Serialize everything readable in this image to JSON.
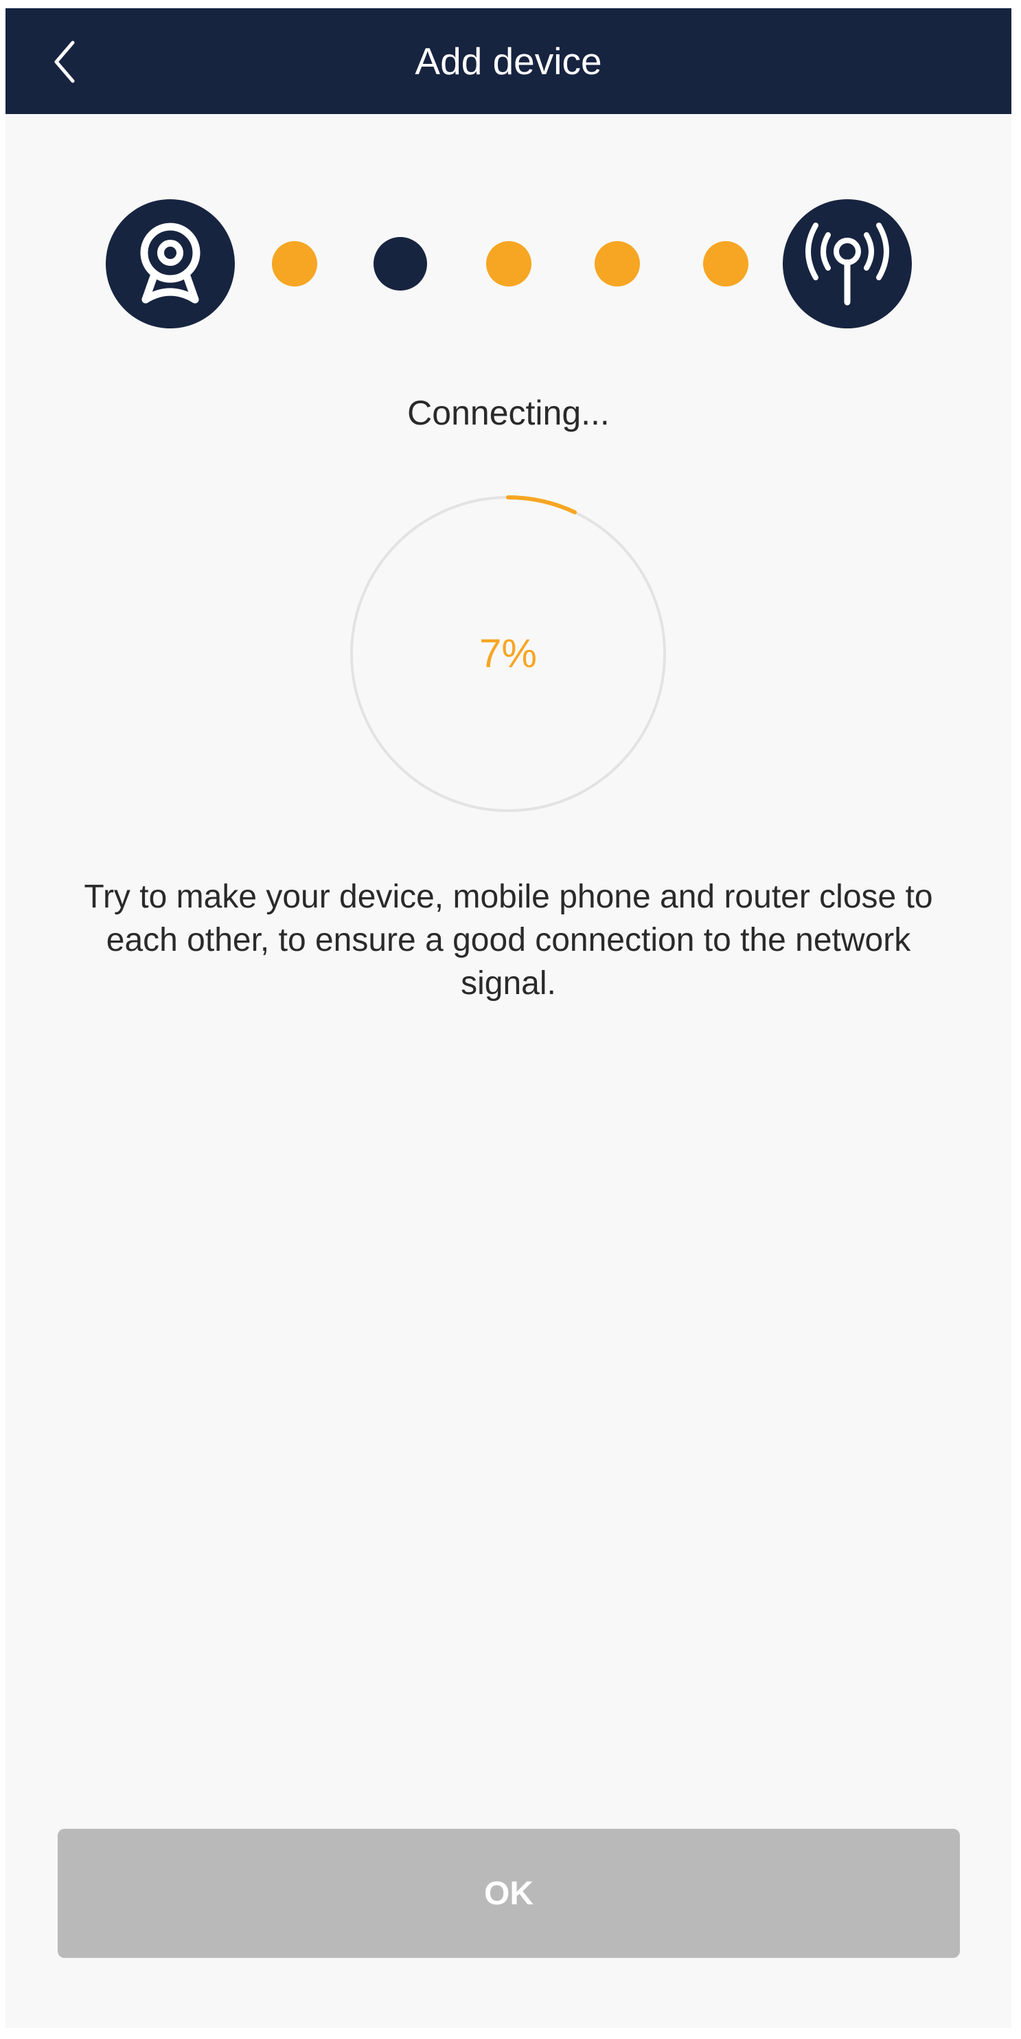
{
  "header": {
    "title": "Add device",
    "back_icon": "chevron-left-icon"
  },
  "stepper": {
    "start_icon": "webcam-icon",
    "end_icon": "antenna-signal-icon",
    "dots": [
      "done",
      "active",
      "done",
      "done",
      "done"
    ]
  },
  "status": {
    "text": "Connecting..."
  },
  "progress": {
    "percent_label": "7%",
    "value": 0.07
  },
  "hint": {
    "text": "Try to make your device, mobile phone and router close to each other, to ensure a good connection to the network signal."
  },
  "footer": {
    "ok_label": "OK"
  },
  "colors": {
    "header_bg": "#172440",
    "accent": "#f6a623",
    "button_disabled": "#b9b9b9"
  }
}
